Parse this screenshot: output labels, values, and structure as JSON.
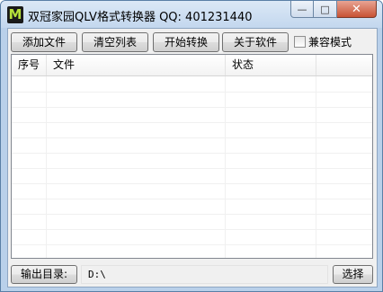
{
  "window": {
    "title": "双冠家园QLV格式转换器 QQ: 401231440",
    "app_icon_glyph": "M"
  },
  "caption": {
    "min_glyph": "—",
    "max_glyph": "□",
    "close_glyph": "✕"
  },
  "toolbar": {
    "add_file_label": "添加文件",
    "clear_list_label": "清空列表",
    "start_convert_label": "开始转换",
    "about_label": "关于软件",
    "compat_mode_label": "兼容模式",
    "compat_mode_checked": false
  },
  "file_list": {
    "columns": [
      "序号",
      "文件",
      "状态"
    ],
    "rows": []
  },
  "output": {
    "label": "输出目录:",
    "path": "D:\\",
    "choose_label": "选择"
  },
  "colors": {
    "close_button": "#c85234",
    "app_icon_fg": "#b6e13a"
  }
}
